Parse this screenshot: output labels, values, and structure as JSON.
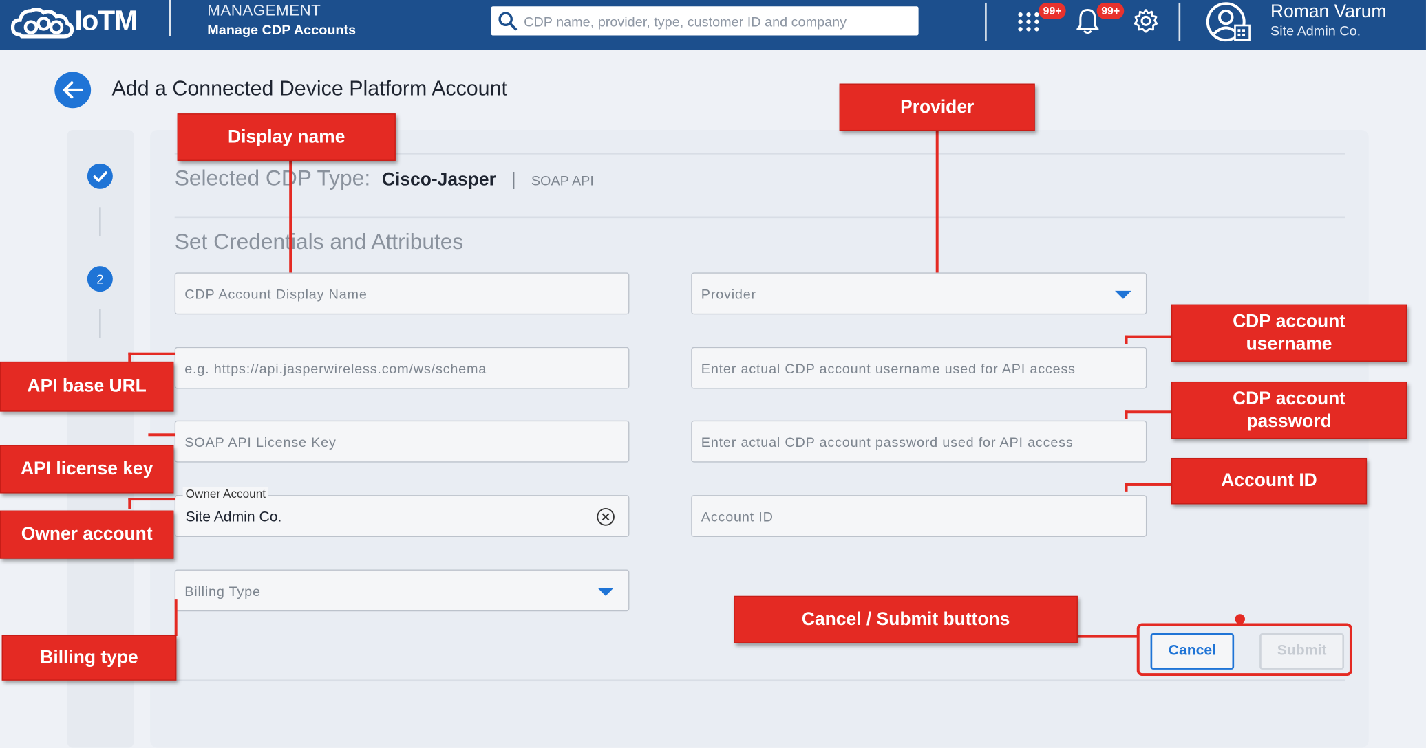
{
  "header": {
    "brand": "IoTM",
    "section_title": "MANAGEMENT",
    "section_subtitle": "Manage CDP Accounts",
    "search_placeholder": "CDP name, provider, type, customer ID and company",
    "apps_badge": "99+",
    "notifications_badge": "99+",
    "user_name": "Roman Varum",
    "user_company": "Site Admin Co."
  },
  "page": {
    "title": "Add a Connected Device Platform Account",
    "selected_type_label": "Selected CDP Type:",
    "selected_type_value": "Cisco-Jasper",
    "selected_type_separator": "|",
    "selected_type_api": "SOAP API",
    "section_title": "Set Credentials and Attributes",
    "steps": [
      {
        "label": "check"
      },
      {
        "label": "2"
      }
    ]
  },
  "form": {
    "display_name_placeholder": "CDP Account Display Name",
    "provider_placeholder": "Provider",
    "api_url_placeholder": "e.g. https://api.jasperwireless.com/ws/schema",
    "username_placeholder": "Enter actual CDP account username used for API access",
    "license_key_placeholder": "SOAP API License Key",
    "password_placeholder": "Enter actual CDP account password used for API access",
    "owner_account_label": "Owner Account",
    "owner_account_value": "Site Admin Co.",
    "account_id_placeholder": "Account ID",
    "billing_type_placeholder": "Billing Type",
    "cancel_label": "Cancel",
    "submit_label": "Submit"
  },
  "annotations": {
    "display_name": "Display name",
    "provider": "Provider",
    "cdp_username": "CDP account username",
    "cdp_password": "CDP account password",
    "account_id": "Account ID",
    "api_base_url": "API base URL",
    "api_license_key": "API license key",
    "owner_account": "Owner account",
    "billing_type": "Billing type",
    "cancel_submit": "Cancel / Submit buttons"
  },
  "colors": {
    "header_bg": "#1c4f8d",
    "accent_blue": "#1f74d6",
    "annotation_red": "#e42a23",
    "badge_red": "#e8322d"
  }
}
